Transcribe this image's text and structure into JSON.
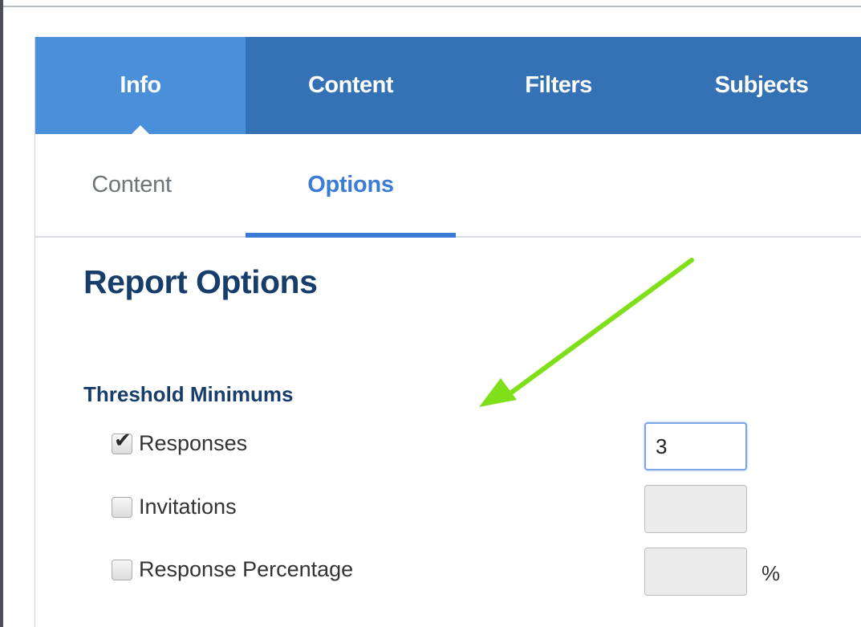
{
  "primary_tabs": [
    {
      "label": "Info",
      "active": true
    },
    {
      "label": "Content",
      "active": false
    },
    {
      "label": "Filters",
      "active": false
    },
    {
      "label": "Subjects",
      "active": false
    }
  ],
  "secondary_tabs": [
    {
      "label": "Content",
      "active": false
    },
    {
      "label": "Options",
      "active": true
    }
  ],
  "report": {
    "title": "Report Options",
    "section_title": "Threshold Minimums",
    "options": [
      {
        "label": "Responses",
        "checked": true,
        "value": "3",
        "unit": ""
      },
      {
        "label": "Invitations",
        "checked": false,
        "value": "",
        "unit": ""
      },
      {
        "label": "Response Percentage",
        "checked": false,
        "value": "",
        "unit": "%"
      }
    ]
  },
  "colors": {
    "tab_bar": "#3571b5",
    "tab_active": "#4a8fd9",
    "accent": "#3a7bd5",
    "heading": "#173d6a",
    "annotation_arrow": "#7fe01a"
  },
  "icons": {
    "check": "check-mark-icon",
    "tab_pointer": "caret-up-icon",
    "annotation": "arrow-annotation-icon"
  }
}
